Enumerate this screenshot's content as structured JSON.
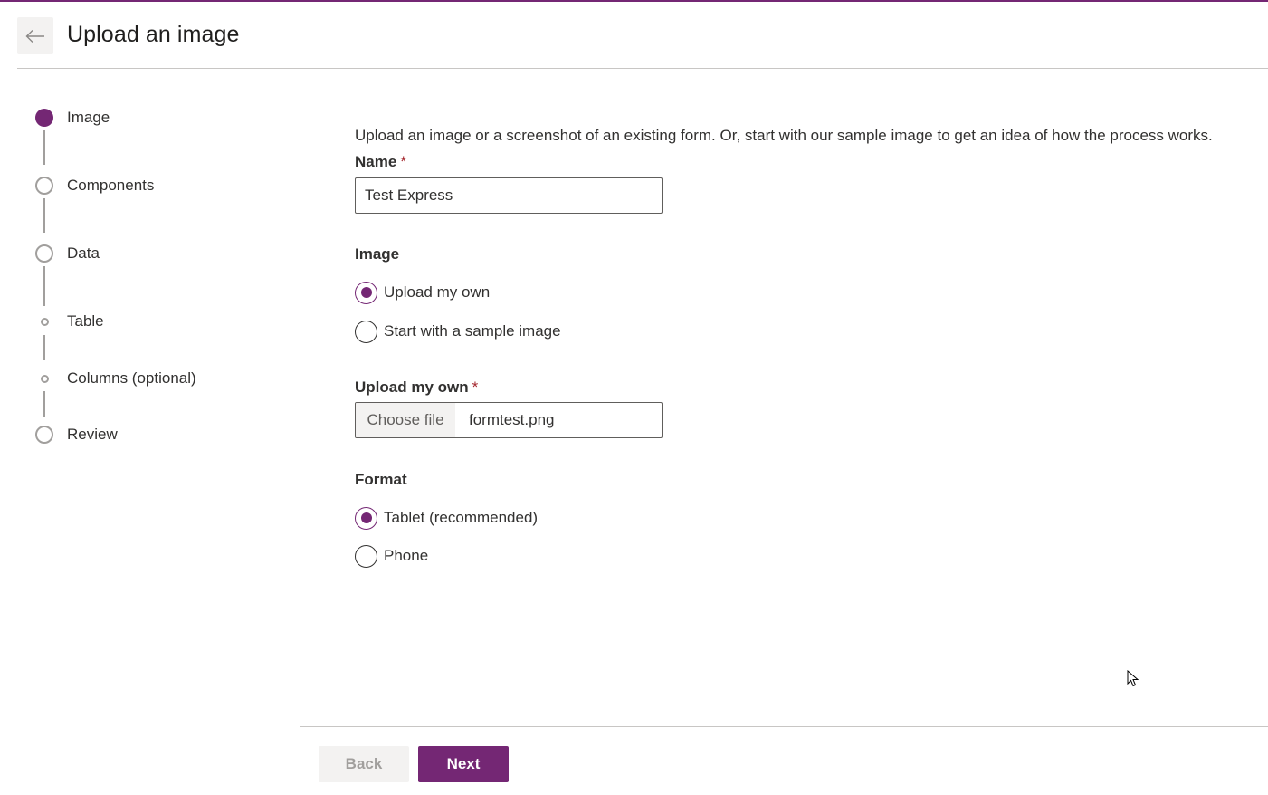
{
  "theme": {
    "accent": "#742774",
    "border": "#c8c6c4",
    "required": "#a4262c"
  },
  "header": {
    "back_icon": "arrow-left-icon",
    "title": "Upload an image"
  },
  "stepper": {
    "steps": [
      {
        "label": "Image",
        "state": "active"
      },
      {
        "label": "Components",
        "state": "pending"
      },
      {
        "label": "Data",
        "state": "pending"
      },
      {
        "label": "Table",
        "state": "sub-pending"
      },
      {
        "label": "Columns (optional)",
        "state": "sub-pending"
      },
      {
        "label": "Review",
        "state": "pending"
      }
    ]
  },
  "form": {
    "description": "Upload an image or a screenshot of an existing form. Or, start with our sample image to get an idea of how the process works.",
    "name_field": {
      "label": "Name",
      "required_mark": "*",
      "value": "Test Express"
    },
    "image_group": {
      "label": "Image",
      "options": [
        {
          "label": "Upload my own",
          "checked": true
        },
        {
          "label": "Start with a sample image",
          "checked": false
        }
      ]
    },
    "upload_field": {
      "label": "Upload my own",
      "required_mark": "*",
      "button_label": "Choose file",
      "file_name": "formtest.png"
    },
    "format_group": {
      "label": "Format",
      "options": [
        {
          "label": "Tablet (recommended)",
          "checked": true
        },
        {
          "label": "Phone",
          "checked": false
        }
      ]
    }
  },
  "footer": {
    "back_label": "Back",
    "back_disabled": true,
    "next_label": "Next"
  }
}
